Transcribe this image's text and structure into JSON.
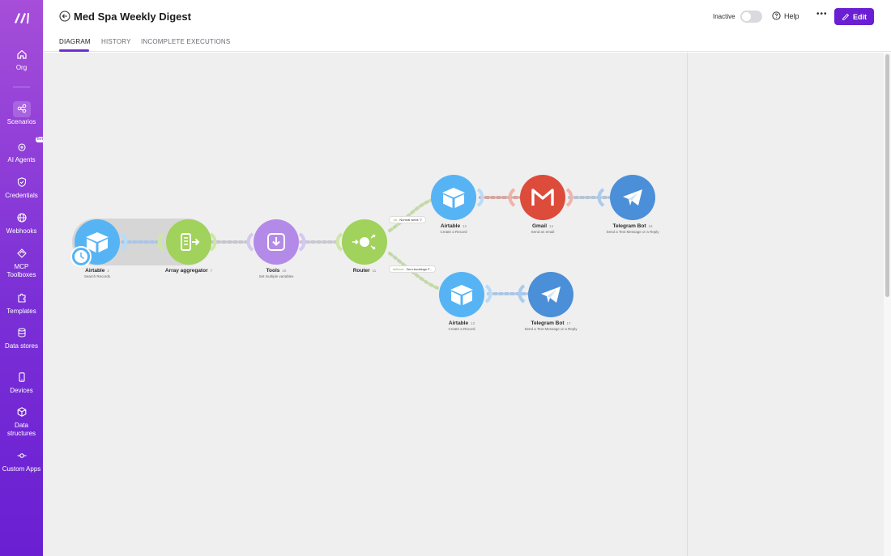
{
  "sidebar": {
    "items": [
      {
        "label": "Org",
        "icon": "home-icon"
      },
      {
        "label": "Scenarios",
        "icon": "share-icon"
      },
      {
        "label": "AI Agents",
        "icon": "ai-agents-icon",
        "badge": "Beta"
      },
      {
        "label": "Credentials",
        "icon": "shield-icon"
      },
      {
        "label": "Webhooks",
        "icon": "globe-icon"
      },
      {
        "label": "MCP Toolboxes",
        "icon": "mcp-icon"
      },
      {
        "label": "Templates",
        "icon": "puzzle-icon"
      },
      {
        "label": "Data stores",
        "icon": "database-icon"
      },
      {
        "label": "Devices",
        "icon": "phone-icon"
      },
      {
        "label": "Data structures",
        "icon": "cube-icon"
      },
      {
        "label": "Custom Apps",
        "icon": "custom-apps-icon"
      }
    ]
  },
  "header": {
    "title": "Med Spa Weekly Digest",
    "tabs": [
      "DIAGRAM",
      "HISTORY",
      "INCOMPLETE EXECUTIONS"
    ],
    "status_label": "Inactive",
    "help_label": "Help",
    "more_label": "•••",
    "edit_label": "Edit"
  },
  "diagram": {
    "modules": [
      {
        "name": "Airtable",
        "num": "2",
        "desc": "Search Records",
        "color": "#2d9cf0"
      },
      {
        "name": "Array aggregator",
        "num": "7",
        "desc": "",
        "color": "#8ec63f"
      },
      {
        "name": "Tools",
        "num": "10",
        "desc": "Set multiple variables",
        "color": "#9c6fe0"
      },
      {
        "name": "Router",
        "num": "11",
        "desc": "",
        "color": "#8ec63f"
      },
      {
        "name": "Airtable",
        "num": "12",
        "desc": "Create a Record",
        "color": "#2d9cf0"
      },
      {
        "name": "Gmail",
        "num": "14",
        "desc": "Send an email",
        "color": "#db3d2e"
      },
      {
        "name": "Telegram Bot",
        "num": "15",
        "desc": "Send a Text Message or a Reply",
        "color": "#2f87d6"
      },
      {
        "name": "Airtable",
        "num": "13",
        "desc": "Create a Record",
        "color": "#2d9cf0"
      },
      {
        "name": "Telegram Bot",
        "num": "17",
        "desc": "Send a Text Message or a Reply",
        "color": "#2f87d6"
      }
    ],
    "routes": [
      {
        "order": "1st",
        "label": "Normal week"
      },
      {
        "order": "fallback",
        "label": "Zero bookings F..."
      }
    ]
  }
}
